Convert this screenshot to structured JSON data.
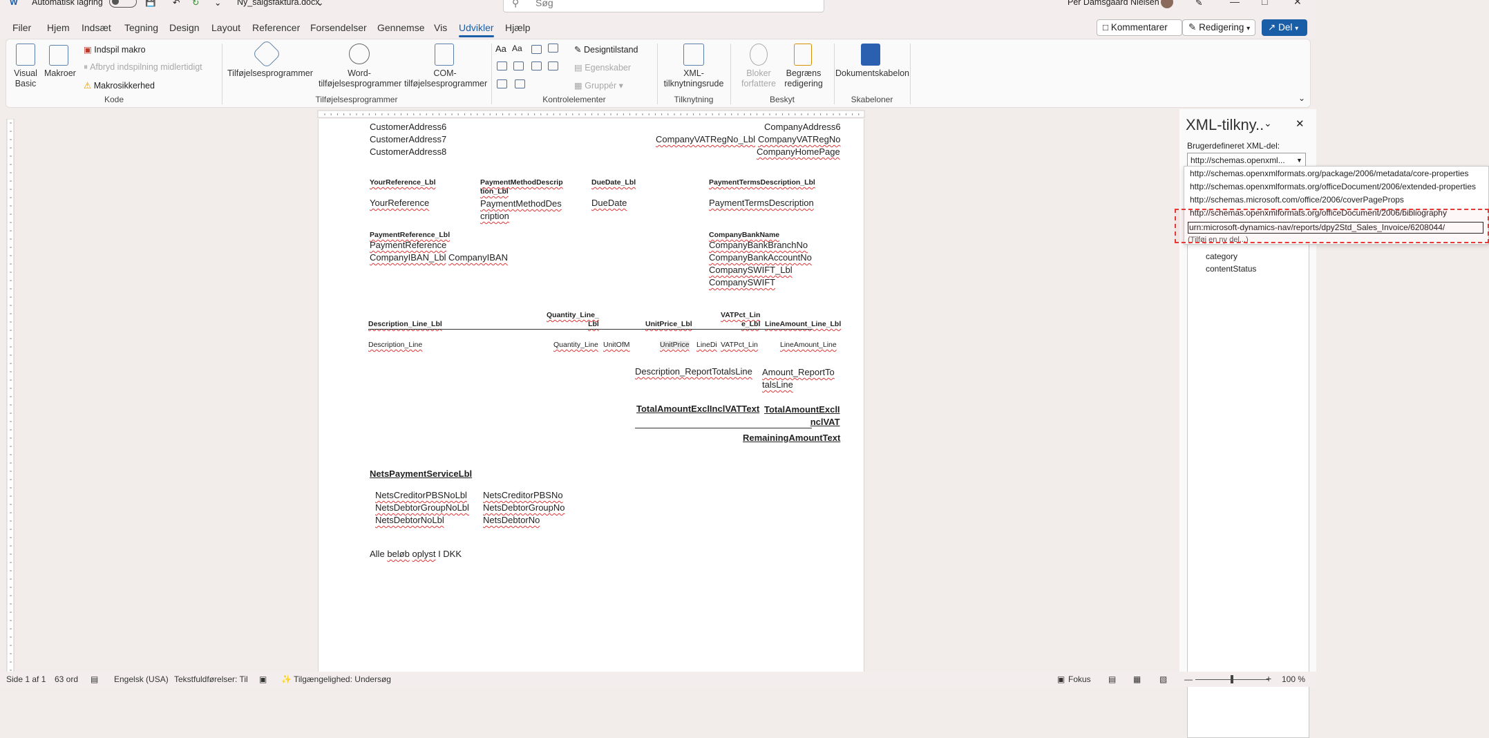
{
  "titlebar": {
    "autosave_label": "Automatisk lagring",
    "filename": "Ny_salgsfaktura.docx",
    "search_placeholder": "Søg",
    "user": "Per Damsgaard Nielsen"
  },
  "menu": {
    "items": [
      "Filer",
      "Hjem",
      "Indsæt",
      "Tegning",
      "Design",
      "Layout",
      "Referencer",
      "Forsendelser",
      "Gennemse",
      "Vis",
      "Udvikler",
      "Hjælp"
    ],
    "active": "Udvikler"
  },
  "top_buttons": {
    "comments": "Kommentarer",
    "editing": "Redigering",
    "share": "Del"
  },
  "ribbon": {
    "code": {
      "group": "Kode",
      "visual_basic": [
        "Visual",
        "Basic"
      ],
      "macros": "Makroer",
      "record_macro": "Indspil makro",
      "pause_recording": "Afbryd indspilning midlertidigt",
      "macro_security": "Makrosikkerhed"
    },
    "addins": {
      "group": "Tilføjelsesprogrammer",
      "addins": "Tilføjelsesprogrammer",
      "word_addins": [
        "Word-",
        "tilføjelsesprogrammer"
      ],
      "com_addins": [
        "COM-",
        "tilføjelsesprogrammer"
      ]
    },
    "controls": {
      "group": "Kontrolelementer",
      "design_mode": "Designtilstand",
      "properties": "Egenskaber",
      "group_btn": "Gruppér",
      "aa1": "Aa",
      "aa2": "Aa"
    },
    "mapping": {
      "group": "Tilknytning",
      "xml_pane": [
        "XML-",
        "tilknytningsrude"
      ]
    },
    "protect": {
      "group": "Beskyt",
      "block_authors": [
        "Bloker",
        "forfattere"
      ],
      "restrict_editing": [
        "Begræns",
        "redigering"
      ]
    },
    "templates": {
      "group": "Skabeloner",
      "doc_template": "Dokumentskabelon"
    }
  },
  "document": {
    "customer_addr6": "CustomerAddress6",
    "customer_addr7": "CustomerAddress7",
    "customer_addr8": "CustomerAddress8",
    "company_addr6": "CompanyAddress6",
    "company_vat_lbl": "CompanyVATRegNo_Lbl",
    "company_vat": "CompanyVATRegNo",
    "company_home": "CompanyHomePage",
    "your_ref_lbl": "YourReference_Lbl",
    "pay_method_lbl": [
      "PaymentMethodDescrip",
      "tion_Lbl"
    ],
    "due_date_lbl": "DueDate_Lbl",
    "pay_terms_lbl": "PaymentTermsDescription_Lbl",
    "your_ref": "YourReference",
    "pay_method": [
      "PaymentMethodDes",
      "cription"
    ],
    "due_date": "DueDate",
    "pay_terms": "PaymentTermsDescription",
    "pay_ref_lbl": "PaymentReference_Lbl",
    "bank_name": "CompanyBankName",
    "pay_ref": "PaymentReference",
    "bank_branch": "CompanyBankBranchNo",
    "iban_lbl": "CompanyIBAN_Lbl",
    "iban": "CompanyIBAN",
    "bank_account": "CompanyBankAccountNo",
    "swift_lbl": "CompanySWIFT_Lbl",
    "swift": "CompanySWIFT",
    "desc_line_lbl": "Description_Line_Lbl",
    "qty_line_lbl": [
      "Quantity_Line_",
      "Lbl"
    ],
    "unit_price_lbl": "UnitPrice_Lbl",
    "vat_pct_lbl": [
      "VATPct_Lin",
      "e_Lbl"
    ],
    "line_amount_lbl": "LineAmount_Line_Lbl",
    "desc_line": "Description_Line",
    "qty_line": "Quantity_Line",
    "unit_of_m": "UnitOfM",
    "unit_price": "UnitPrice",
    "line_di": "LineDi",
    "vat_pct_line": "VATPct_Lin",
    "line_amount": "LineAmount_Line",
    "desc_totals": "Description_ReportTotalsLine",
    "amount_totals": [
      "Amount_ReportTo",
      "talsLine"
    ],
    "total_excl_text": "TotalAmountExclInclVATText",
    "total_excl": [
      "TotalAmountExclI",
      "nclVAT"
    ],
    "remaining_text": "RemainingAmountText",
    "nets_lbl": "NetsPaymentServiceLbl",
    "nets_creditor_lbl": "NetsCreditorPBSNoLbl",
    "nets_creditor": "NetsCreditorPBSNo",
    "nets_debtor_group_lbl": "NetsDebtorGroupNoLbl",
    "nets_debtor_group": "NetsDebtorGroupNo",
    "nets_debtor_lbl": "NetsDebtorNoLbl",
    "nets_debtor": "NetsDebtorNo",
    "footer_words": [
      "Alle",
      "beløb",
      "oplyst",
      "I DKK"
    ]
  },
  "xml_pane": {
    "title": "XML-tilkny..",
    "custom_part_label": "Brugerdefineret XML-del:",
    "combo_value": "http://schemas.openxml...",
    "options": [
      "http://schemas.openxmlformats.org/package/2006/metadata/core-properties",
      "http://schemas.openxmlformats.org/officeDocument/2006/extended-properties",
      "http://schemas.microsoft.com/office/2006/coverPageProps",
      "http://schemas.openxmlformats.org/officeDocument/2006/bibliography",
      "urn:microsoft-dynamics-nav/reports/dpy2Std_Sales_Invoice/6208044/",
      "(Tilføj en ny del...)"
    ],
    "tree_items": [
      "category",
      "contentStatus"
    ]
  },
  "statusbar": {
    "page": "Side 1 af 1",
    "words": "63 ord",
    "language": "Engelsk (USA)",
    "text_predictions": "Tekstfuldførelser: Til",
    "accessibility": "Tilgængelighed: Undersøg",
    "focus": "Fokus",
    "zoom": "100 %",
    "zoom_level": 1.0
  },
  "colors": {
    "accent": "#1b5ea8",
    "highlight_box": "#e53935",
    "squiggle": "#e03333"
  }
}
